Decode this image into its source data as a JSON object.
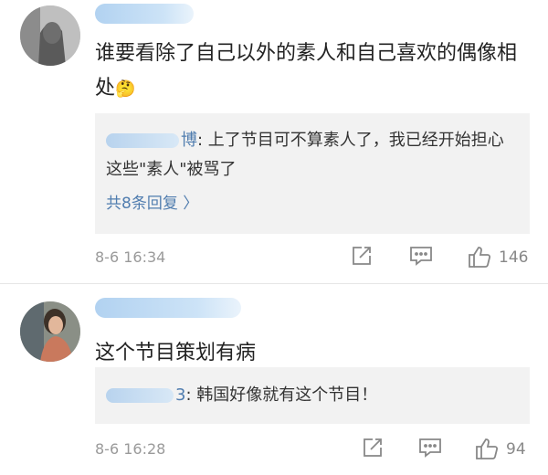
{
  "comments": [
    {
      "text": "谁要看除了自己以外的素人和自己喜欢的偶像相处",
      "emoji": "🤔",
      "reply": {
        "author_suffix": "博",
        "text": "上了节目可不算素人了，我已经开始担心这些\"素人\"被骂了"
      },
      "more_replies": "共8条回复 〉",
      "time": "8-6 16:34",
      "likes": "146"
    },
    {
      "text": "这个节目策划有病",
      "reply": {
        "author_suffix": "3",
        "text": "韩国好像就有这个节目！"
      },
      "time": "8-6 16:28",
      "likes": "94"
    }
  ],
  "icons": {
    "share": "share-icon",
    "comment": "comment-icon",
    "like": "like-icon"
  },
  "colors": {
    "link": "#507daf",
    "meta": "#9a9a9a",
    "reply_bg": "#f2f2f2"
  }
}
